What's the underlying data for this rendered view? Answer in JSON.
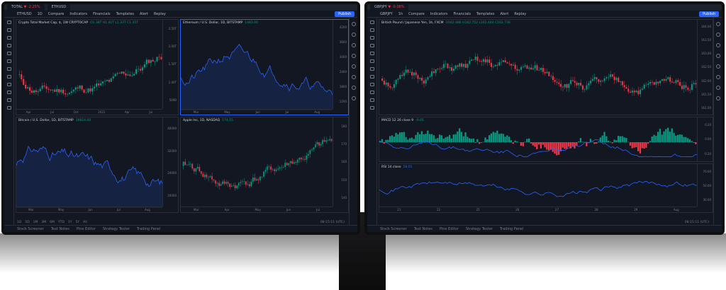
{
  "left": {
    "tabs": [
      {
        "label": "TOTAL",
        "change": "▼ -2.25%"
      },
      {
        "label": "ETHUSD",
        "change": ""
      }
    ],
    "toolbar": [
      "ETHUSD",
      "1D",
      "Compare",
      "Indicators",
      "Financials",
      "Templates",
      "Alert",
      "Replay"
    ],
    "publish": "Publish",
    "bottom_tabs": [
      "Stock Screener",
      "Text Notes",
      "Pine Editor",
      "Strategy Tester",
      "Trading Panel"
    ],
    "ranges": [
      "1D",
      "5D",
      "1M",
      "3M",
      "6M",
      "YTD",
      "1Y",
      "5Y",
      "All"
    ],
    "clock": "08:15:11 (UTC)",
    "panes": [
      {
        "title": "Crypto Total Market Cap, $, 1W CRYPTOCAP",
        "values": "O1.38T H1.41T L1.33T C1.35T"
      },
      {
        "title": "Ethereum / U.S. Dollar, 1D, BITSTAMP",
        "values": "1483.00"
      },
      {
        "title": "Bitcoin / U.S. Dollar, 1D, BITSTAMP",
        "values": "19814.00"
      },
      {
        "title": "Apple Inc, 1D, NASDAQ",
        "values": "174.55"
      }
    ]
  },
  "right": {
    "tabs": [
      {
        "label": "GBPJPY",
        "change": "▼ -0.08%"
      }
    ],
    "toolbar": [
      "GBPJPY",
      "1h",
      "Compare",
      "Indicators",
      "Financials",
      "Templates",
      "Alert",
      "Replay"
    ],
    "publish": "Publish",
    "bottom_tabs": [
      "Stock Screener",
      "Text Notes",
      "Pine Editor",
      "Strategy Tester",
      "Trading Panel"
    ],
    "clock": "08:15:11 (UTC)",
    "panes": [
      {
        "title": "British Pound / Japanese Yen, 1h, FXCM",
        "values": "O162.486 H162.752 L162.444 C162.736"
      },
      {
        "title": "MACD 12 26 close 9",
        "values": "-0.05"
      },
      {
        "title": "RSI 14 close",
        "values": "58.05"
      }
    ]
  },
  "colors": {
    "bg": "#131722",
    "up": "#089981",
    "down": "#f23645",
    "accent": "#2962ff"
  }
}
